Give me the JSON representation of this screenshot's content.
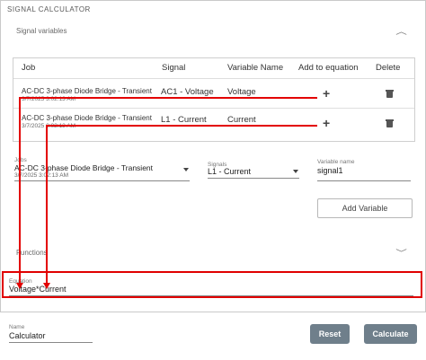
{
  "panel_title": "SIGNAL CALCULATOR",
  "signal_variables": {
    "title": "Signal variables",
    "chevron": "chevron-up-icon"
  },
  "table": {
    "headers": [
      "Job",
      "Signal",
      "Variable Name",
      "Add to equation",
      "Delete"
    ],
    "rows": [
      {
        "job": "AC-DC 3-phase Diode Bridge - Transient",
        "date": "3/7/2025 3:02:13 AM",
        "signal": "AC1 - Voltage",
        "variable": "Voltage",
        "add_icon": "plus-icon",
        "delete_icon": "trash-icon"
      },
      {
        "job": "AC-DC 3-phase Diode Bridge - Transient",
        "date": "3/7/2025 3:02:13 AM",
        "signal": "L1 - Current",
        "variable": "Current",
        "add_icon": "plus-icon",
        "delete_icon": "trash-icon"
      }
    ]
  },
  "form": {
    "jobs_label": "Jobs",
    "jobs_value": "AC-DC 3-phase Diode Bridge - Transient",
    "jobs_date": "3/7/2025 3:02:13 AM",
    "signals_label": "Signals",
    "signals_value": "L1 - Current",
    "varname_label": "Variable name",
    "varname_value": "signal1",
    "add_variable": "Add Variable"
  },
  "functions": {
    "title": "Functions",
    "chevron": "chevron-down-icon"
  },
  "equation": {
    "label": "Equation",
    "value": "Voltage*Current"
  },
  "name": {
    "label": "Name",
    "value": "Calculator"
  },
  "buttons": {
    "reset": "Reset",
    "calculate": "Calculate"
  },
  "colors": {
    "annotation_red": "#e30000",
    "button_gray": "#6f7f8b"
  }
}
